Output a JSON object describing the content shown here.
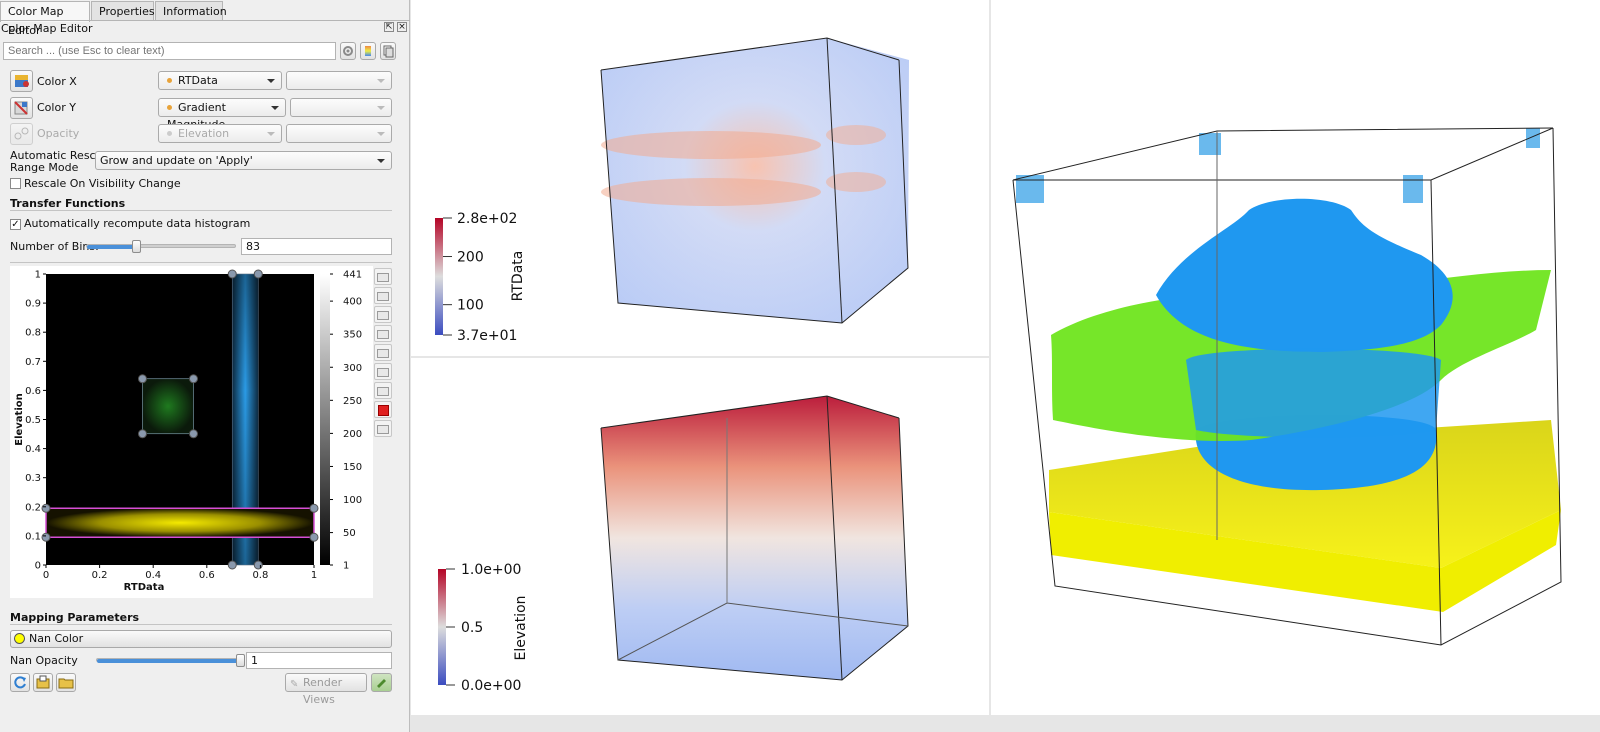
{
  "tabs": [
    {
      "label": "Color Map Editor",
      "active": true
    },
    {
      "label": "Properties",
      "active": false
    },
    {
      "label": "Information",
      "active": false
    }
  ],
  "panel_title": "Color Map Editor",
  "search": {
    "placeholder": "Search ... (use Esc to clear text)"
  },
  "color_x": {
    "label": "Color X",
    "array": "RTData"
  },
  "color_y": {
    "label": "Color Y",
    "array": "Gradient Magnitude"
  },
  "opacity": {
    "label": "Opacity",
    "array": "Elevation"
  },
  "rescale": {
    "label": "Automatic Rescale Range Mode",
    "label_line1": "Automatic Rescale",
    "label_line2": "Range Mode",
    "value": "Grow and update on 'Apply'"
  },
  "rescale_visibility": {
    "label": "Rescale On Visibility Change",
    "checked": false
  },
  "transfer_functions": {
    "title": "Transfer Functions",
    "auto_histogram": {
      "label": "Automatically recompute data histogram",
      "checked": true
    },
    "bins": {
      "label": "Number of Bins:",
      "value": "83",
      "slider_fraction": 0.33
    }
  },
  "tf_chart": {
    "xlabel": "RTData",
    "ylabel": "Elevation",
    "x_ticks": [
      "0",
      "0.2",
      "0.4",
      "0.6",
      "0.8",
      "1"
    ],
    "y_ticks": [
      "0",
      "0.1",
      "0.2",
      "0.3",
      "0.4",
      "0.5",
      "0.6",
      "0.7",
      "0.8",
      "0.9",
      "1"
    ],
    "hist_ticks": [
      "441",
      "400",
      "350",
      "300",
      "250",
      "200",
      "150",
      "100",
      "50",
      "1"
    ],
    "colors": {
      "green": "#1f8a1f",
      "blue": "#2b9be6",
      "yellow": "#f2e600",
      "selection": "#d64fd6"
    }
  },
  "mapping": {
    "title": "Mapping Parameters",
    "nan_color": {
      "label": "Nan Color",
      "color": "#ffff00"
    },
    "nan_opacity": {
      "label": "Nan Opacity",
      "value": "1",
      "slider_fraction": 1.0
    },
    "render_views": "Render Views"
  },
  "view_top": {
    "scalar_bar": {
      "title": "RTData",
      "ticks": [
        "2.8e+02",
        "200",
        "100",
        "3.7e+01"
      ]
    }
  },
  "view_bottom": {
    "scalar_bar": {
      "title": "Elevation",
      "ticks": [
        "1.0e+00",
        "0.5",
        "0.0e+00"
      ]
    }
  },
  "colors": {
    "accent": "#4a90d9",
    "green_surface": "#6fe51e",
    "blue_surface": "#1f98f0",
    "yellow_slab": "#f5f000"
  }
}
